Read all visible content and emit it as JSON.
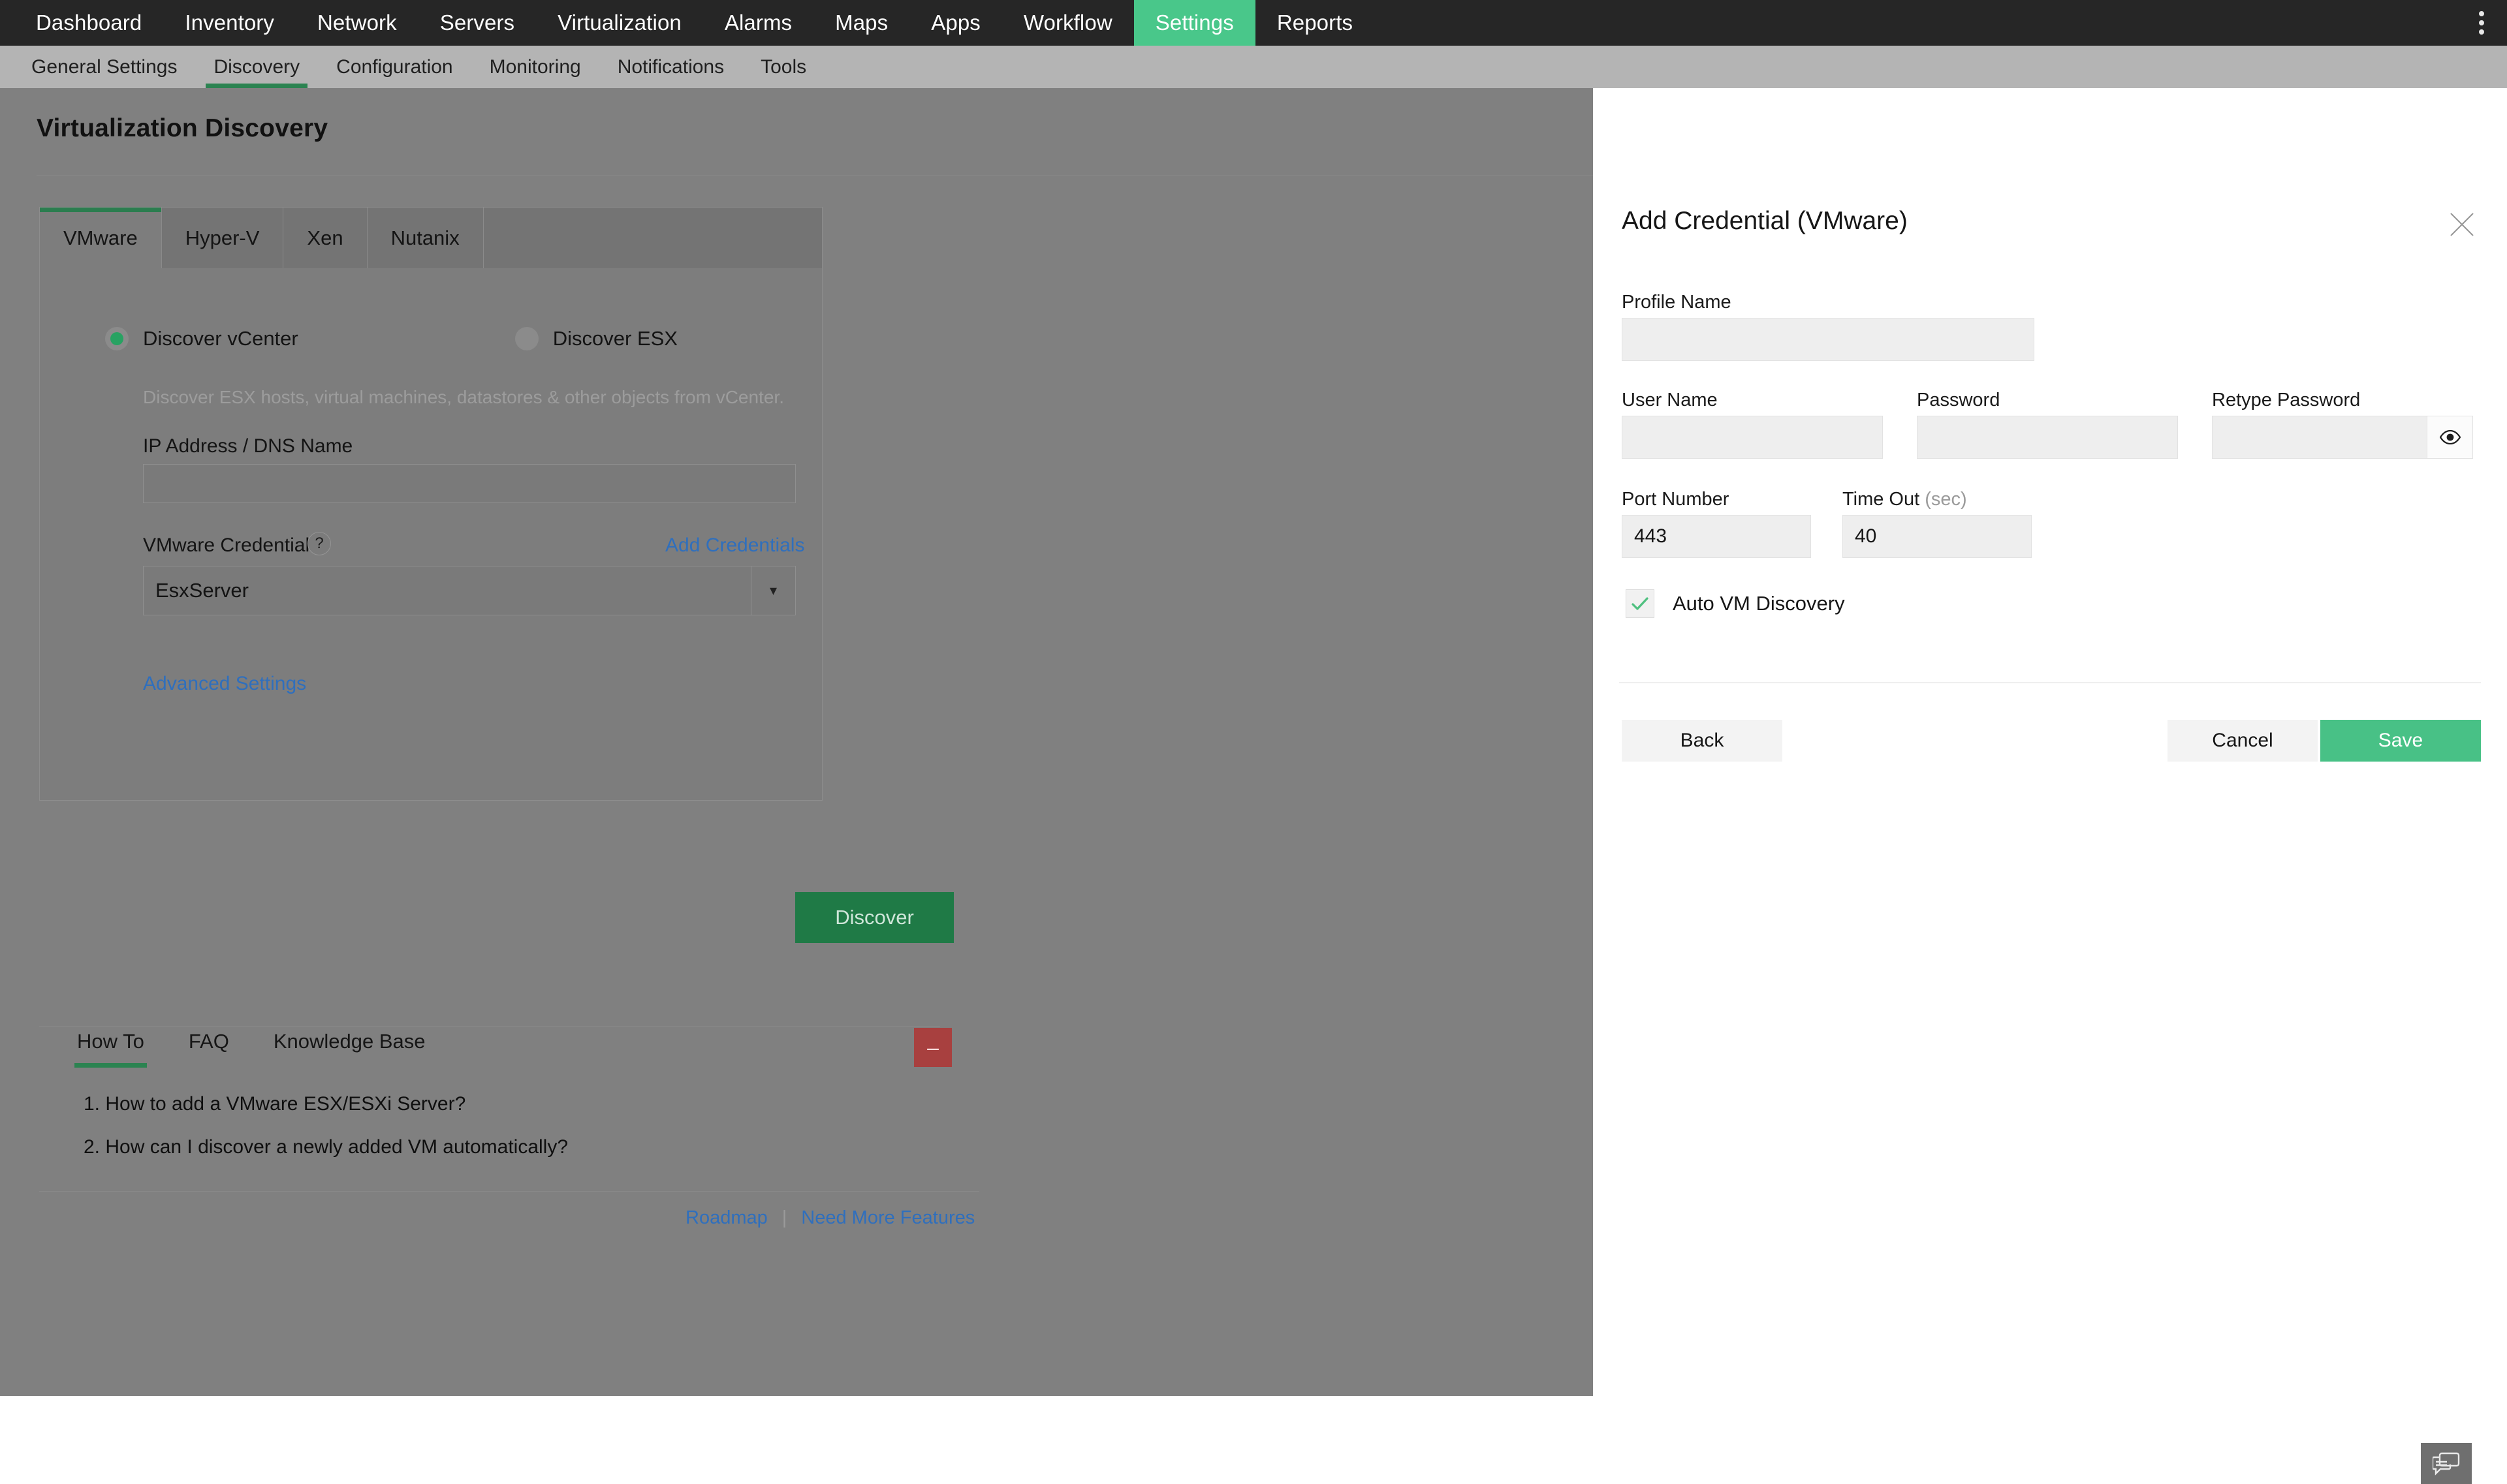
{
  "top_nav": {
    "items": [
      {
        "label": "Dashboard",
        "active": false
      },
      {
        "label": "Inventory",
        "active": false
      },
      {
        "label": "Network",
        "active": false
      },
      {
        "label": "Servers",
        "active": false
      },
      {
        "label": "Virtualization",
        "active": false
      },
      {
        "label": "Alarms",
        "active": false
      },
      {
        "label": "Maps",
        "active": false
      },
      {
        "label": "Apps",
        "active": false
      },
      {
        "label": "Workflow",
        "active": false
      },
      {
        "label": "Settings",
        "active": true
      },
      {
        "label": "Reports",
        "active": false
      }
    ],
    "menu_icon": "kebab-menu-icon"
  },
  "sub_nav": {
    "items": [
      {
        "label": "General Settings",
        "active": false
      },
      {
        "label": "Discovery",
        "active": true
      },
      {
        "label": "Configuration",
        "active": false
      },
      {
        "label": "Monitoring",
        "active": false
      },
      {
        "label": "Notifications",
        "active": false
      },
      {
        "label": "Tools",
        "active": false
      }
    ]
  },
  "page": {
    "title": "Virtualization Discovery"
  },
  "vm_card": {
    "tabs": [
      {
        "label": "VMware",
        "active": true
      },
      {
        "label": "Hyper-V",
        "active": false
      },
      {
        "label": "Xen",
        "active": false
      },
      {
        "label": "Nutanix",
        "active": false
      }
    ],
    "radio_options": [
      {
        "label": "Discover vCenter",
        "selected": true
      },
      {
        "label": "Discover ESX",
        "selected": false
      }
    ],
    "hint": "Discover ESX hosts, virtual machines, datastores & other objects from vCenter.",
    "ip_label": "IP Address / DNS Name",
    "ip_value": "",
    "ip_placeholder": "",
    "credential_label": "VMware Credential",
    "credential_help_glyph": "?",
    "add_credentials_link": "Add Credentials",
    "credential_selected": "EsxServer",
    "credential_caret": "▾",
    "advanced_settings_link": "Advanced Settings"
  },
  "discover_button": {
    "label": "Discover"
  },
  "help": {
    "tabs": [
      {
        "label": "How To",
        "active": true
      },
      {
        "label": "FAQ",
        "active": false
      },
      {
        "label": "Knowledge Base",
        "active": false
      }
    ],
    "collapse_glyph": "–",
    "items": [
      "1. How to add a VMware ESX/ESXi Server?",
      "2. How can I discover a newly added VM automatically?"
    ]
  },
  "footer": {
    "roadmap": "Roadmap",
    "separator": "|",
    "need_more_features": "Need More Features"
  },
  "chat_fab": {
    "icon": "chat-bubbles-icon"
  },
  "modal": {
    "title": "Add Credential (VMware)",
    "close_icon": "close-icon",
    "profile_name_label": "Profile Name",
    "profile_name_value": "",
    "user_name_label": "User Name",
    "user_name_value": "",
    "password_label": "Password",
    "password_value": "",
    "retype_password_label": "Retype Password",
    "retype_password_value": "",
    "eye_icon": "eye-icon",
    "port_number_label": "Port Number",
    "port_number_value": "443",
    "time_out_label": "Time Out",
    "time_out_unit": "(sec)",
    "time_out_value": "40",
    "auto_vm_discovery_label": "Auto VM Discovery",
    "auto_vm_discovery_checked": true,
    "back_label": "Back",
    "cancel_label": "Cancel",
    "save_label": "Save"
  },
  "colors": {
    "top_nav_bg": "#262626",
    "accent_green": "#49c78a",
    "tab_underline_green": "#2b8351",
    "discover_green": "#1f7a46",
    "save_green": "#48c186",
    "link_blue": "#2f6fbd",
    "collapse_red": "#a8403f",
    "overlay_gray": "#808080"
  }
}
